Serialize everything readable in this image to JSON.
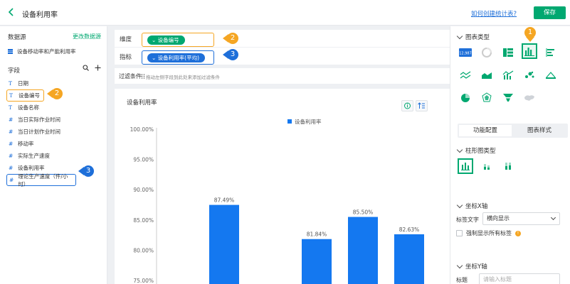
{
  "header": {
    "title": "设备利用率",
    "help_link": "如何创建统计表?",
    "save_label": "保存"
  },
  "left": {
    "datasource_title": "数据源",
    "datasource_change": "更改数据源",
    "datasource_item": "设备移动率和产能利用率",
    "fields_title": "字段",
    "fields": [
      {
        "type": "T",
        "label": "日期"
      },
      {
        "type": "T",
        "label": "设备编号"
      },
      {
        "type": "T",
        "label": "设备名称"
      },
      {
        "type": "#",
        "label": "当日实际作业时间"
      },
      {
        "type": "#",
        "label": "当日计划作业时间"
      },
      {
        "type": "#",
        "label": "移动率"
      },
      {
        "type": "#",
        "label": "实际生产速度"
      },
      {
        "type": "#",
        "label": "设备利用率"
      },
      {
        "type": "#",
        "label": "理论生产速度（件/小时）"
      }
    ]
  },
  "badges": {
    "one": "1",
    "two": "2",
    "three": "3"
  },
  "dimension": {
    "label": "维度",
    "pill": "设备编号"
  },
  "metric": {
    "label": "指标",
    "pill": "设备利用率(平均)"
  },
  "filter": {
    "label": "过滤条件",
    "hint": "拖动左侧字段到此处来添加过滤条件"
  },
  "chart_data": {
    "type": "bar",
    "title": "设备利用率",
    "series": [
      {
        "name": "设备利用率",
        "values": [
          87.49,
          81.84,
          85.5,
          82.63
        ]
      }
    ],
    "labels": [
      "87.49%",
      "81.84%",
      "85.50%",
      "82.63%"
    ],
    "y_ticks": [
      "100.00%",
      "95.00%",
      "90.00%",
      "85.00%",
      "80.00%",
      "75.00%"
    ],
    "ylim": [
      75,
      100
    ],
    "color": "#1478f0",
    "legend": "top-center",
    "grid": false
  },
  "right": {
    "chart_type_title": "图表类型",
    "counter_text": "12,987",
    "tab_function": "功能配置",
    "tab_style": "图表样式",
    "bar_type_title": "柱形图类型",
    "x_axis_title": "坐标X轴",
    "label_text_label": "标签文字",
    "label_text_value": "横向显示",
    "force_show_labels": "强制显示所有标签",
    "y_axis_title": "坐标Y轴",
    "y_title_label": "标题",
    "y_title_placeholder": "请输入标题"
  },
  "colors": {
    "accent": "#00a870",
    "blue": "#1e6fd9",
    "orange": "#f5a623",
    "bar": "#1478f0"
  }
}
